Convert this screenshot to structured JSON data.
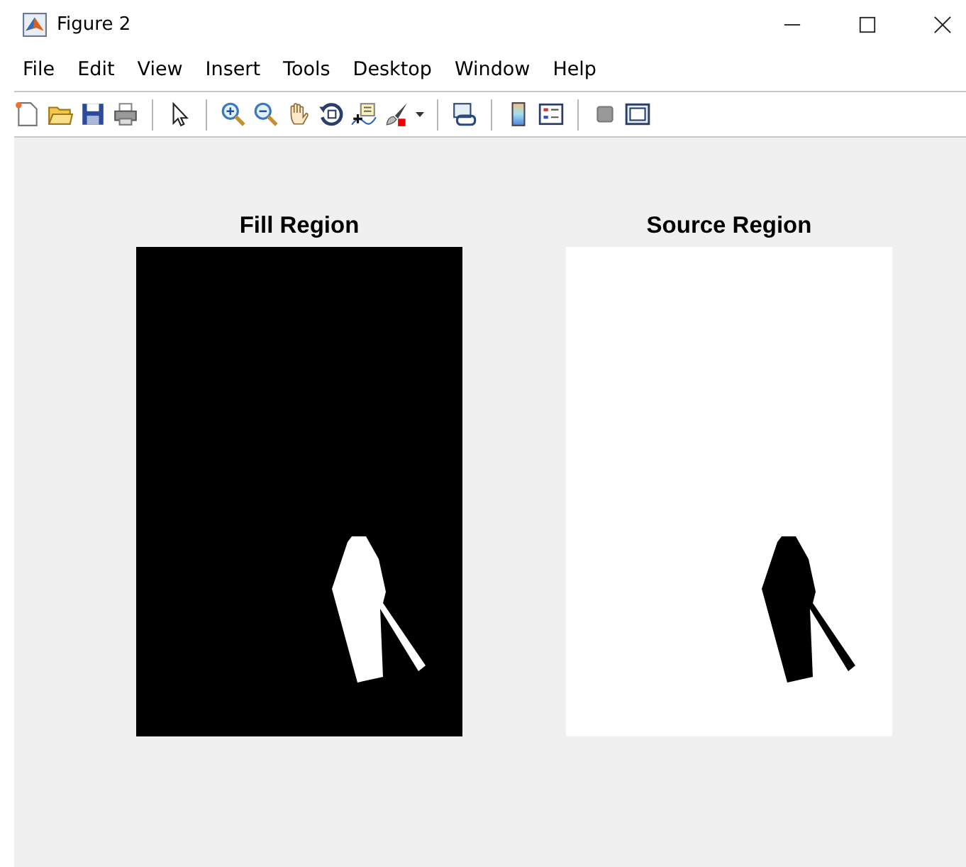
{
  "window": {
    "title": "Figure 2"
  },
  "menu": [
    "File",
    "Edit",
    "View",
    "Insert",
    "Tools",
    "Desktop",
    "Window",
    "Help"
  ],
  "axes": [
    {
      "title": "Fill Region",
      "kind": "fill"
    },
    {
      "title": "Source Region",
      "kind": "source"
    }
  ]
}
